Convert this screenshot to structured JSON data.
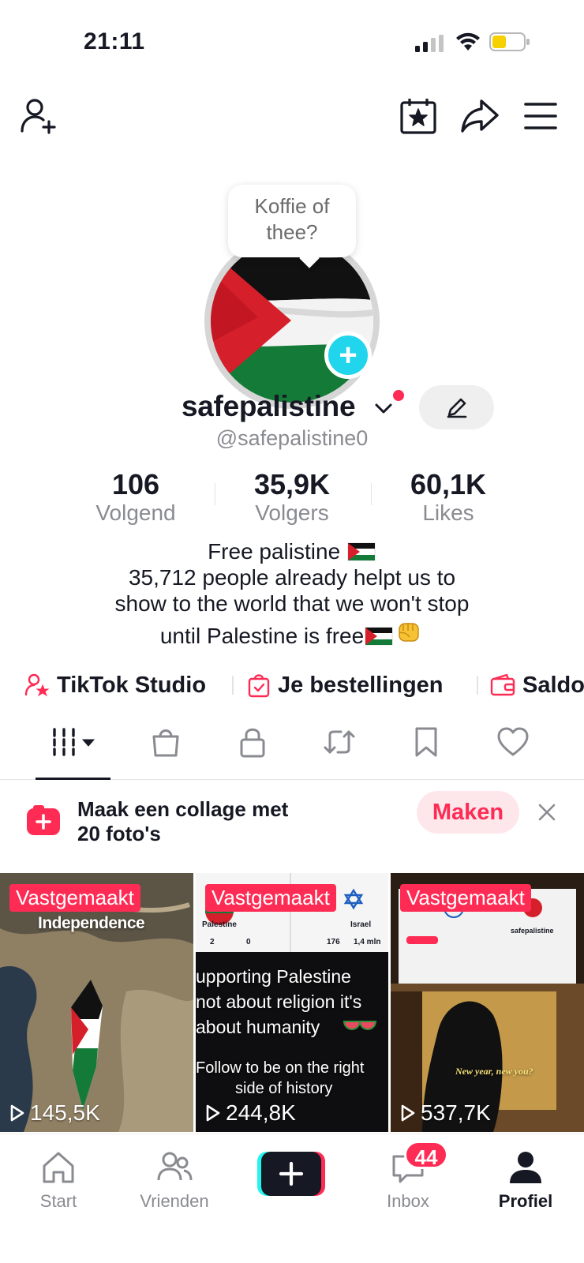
{
  "status_bar": {
    "time": "21:11"
  },
  "top_bar": {
    "icons": [
      "add-friend-icon",
      "calendar-star-icon",
      "share-icon",
      "menu-icon"
    ]
  },
  "avatar": {
    "bubble_text_line1": "Koffie of",
    "bubble_text_line2": "thee?",
    "plus_label": "+"
  },
  "profile": {
    "username": "safepalistine",
    "handle": "@safepalistine0"
  },
  "stats": [
    {
      "value": "106",
      "label": "Volgend"
    },
    {
      "value": "35,9K",
      "label": "Volgers"
    },
    {
      "value": "60,1K",
      "label": "Likes"
    }
  ],
  "bio": {
    "line1": "Free palistine",
    "line2": "35,712 people already helpt us to",
    "line3": "show to the world that we won't stop",
    "line4": "until Palestine is free"
  },
  "links": [
    {
      "label": "TikTok Studio",
      "icon": "user-star-icon"
    },
    {
      "label": "Je bestellingen",
      "icon": "order-bag-icon"
    },
    {
      "label": "Saldo",
      "icon": "wallet-icon"
    }
  ],
  "tabs": [
    "grid-icon",
    "shop-bag-icon",
    "lock-icon",
    "repost-icon",
    "bookmark-icon",
    "heart-icon"
  ],
  "collage": {
    "line1": "Maak een collage met",
    "line2": "20 foto's",
    "button": "Maken"
  },
  "videos": [
    {
      "badge": "Vastgemaakt",
      "views": "145,5K",
      "caption": "Independence"
    },
    {
      "badge": "Vastgemaakt",
      "views": "244,8K",
      "caption_l1": "upporting Palestine",
      "caption_l2": "not about religion it's",
      "caption_l3": "about humanity",
      "caption_l4": "Follow to be on the right",
      "caption_l5": "side of history",
      "card_left_title": "Palestine",
      "card_right_title": "Israel",
      "card_left_stat1": "2",
      "card_left_stat2": "0",
      "card_right_stat1": "176",
      "card_right_stat2": "1,4 mln"
    },
    {
      "badge": "Vastgemaakt",
      "views": "537,7K",
      "caption": "New year, new you?",
      "card_right_title": "safepalistine"
    }
  ],
  "bottom_nav": [
    {
      "label": "Start",
      "icon": "home-icon"
    },
    {
      "label": "Vrienden",
      "icon": "friends-icon"
    },
    {
      "label": "",
      "icon": "create-plus-icon"
    },
    {
      "label": "Inbox",
      "icon": "inbox-icon",
      "badge": "44"
    },
    {
      "label": "Profiel",
      "icon": "profile-icon"
    }
  ],
  "colors": {
    "accent": "#fe2c55",
    "cyan": "#20d5ec",
    "text_primary": "#161823",
    "text_secondary": "#8a8b91"
  }
}
